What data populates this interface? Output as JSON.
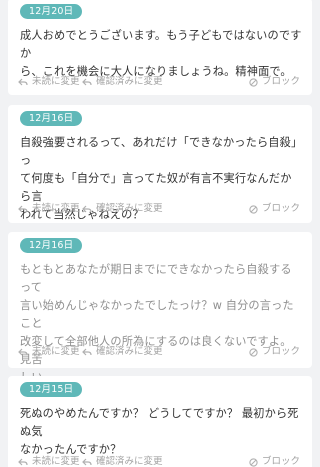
{
  "actions": {
    "unread": "未読に変更",
    "confirmed": "確認済みに変更",
    "block": "ブロック"
  },
  "messages": [
    {
      "date": "12月20日",
      "lines": [
        "成人おめでとうございます。もう子どもではないのですか",
        "ら、これを機会に大人になりましょうね。精神面で。"
      ]
    },
    {
      "date": "12月16日",
      "lines": [
        "自殺強要されるって、あれだけ「できなかったら自殺」っ",
        "て何度も「自分で」言ってた奴が有言不実行なんだから言",
        "われて当然じゃねえの？"
      ]
    },
    {
      "date": "12月16日",
      "lines": [
        "もともとあなたが期日までにできなかったら自殺するって",
        "言い始めんじゃなかったでしたっけ？w 自分の言ったこと",
        "改変して全部他人の所為にするのは良くないですよ。見苦",
        "しい"
      ]
    },
    {
      "date": "12月15日",
      "lines": [
        "死ぬのやめたんですか？ どうしてですか？ 最初から死ぬ気",
        "なかったんですか？"
      ]
    }
  ]
}
